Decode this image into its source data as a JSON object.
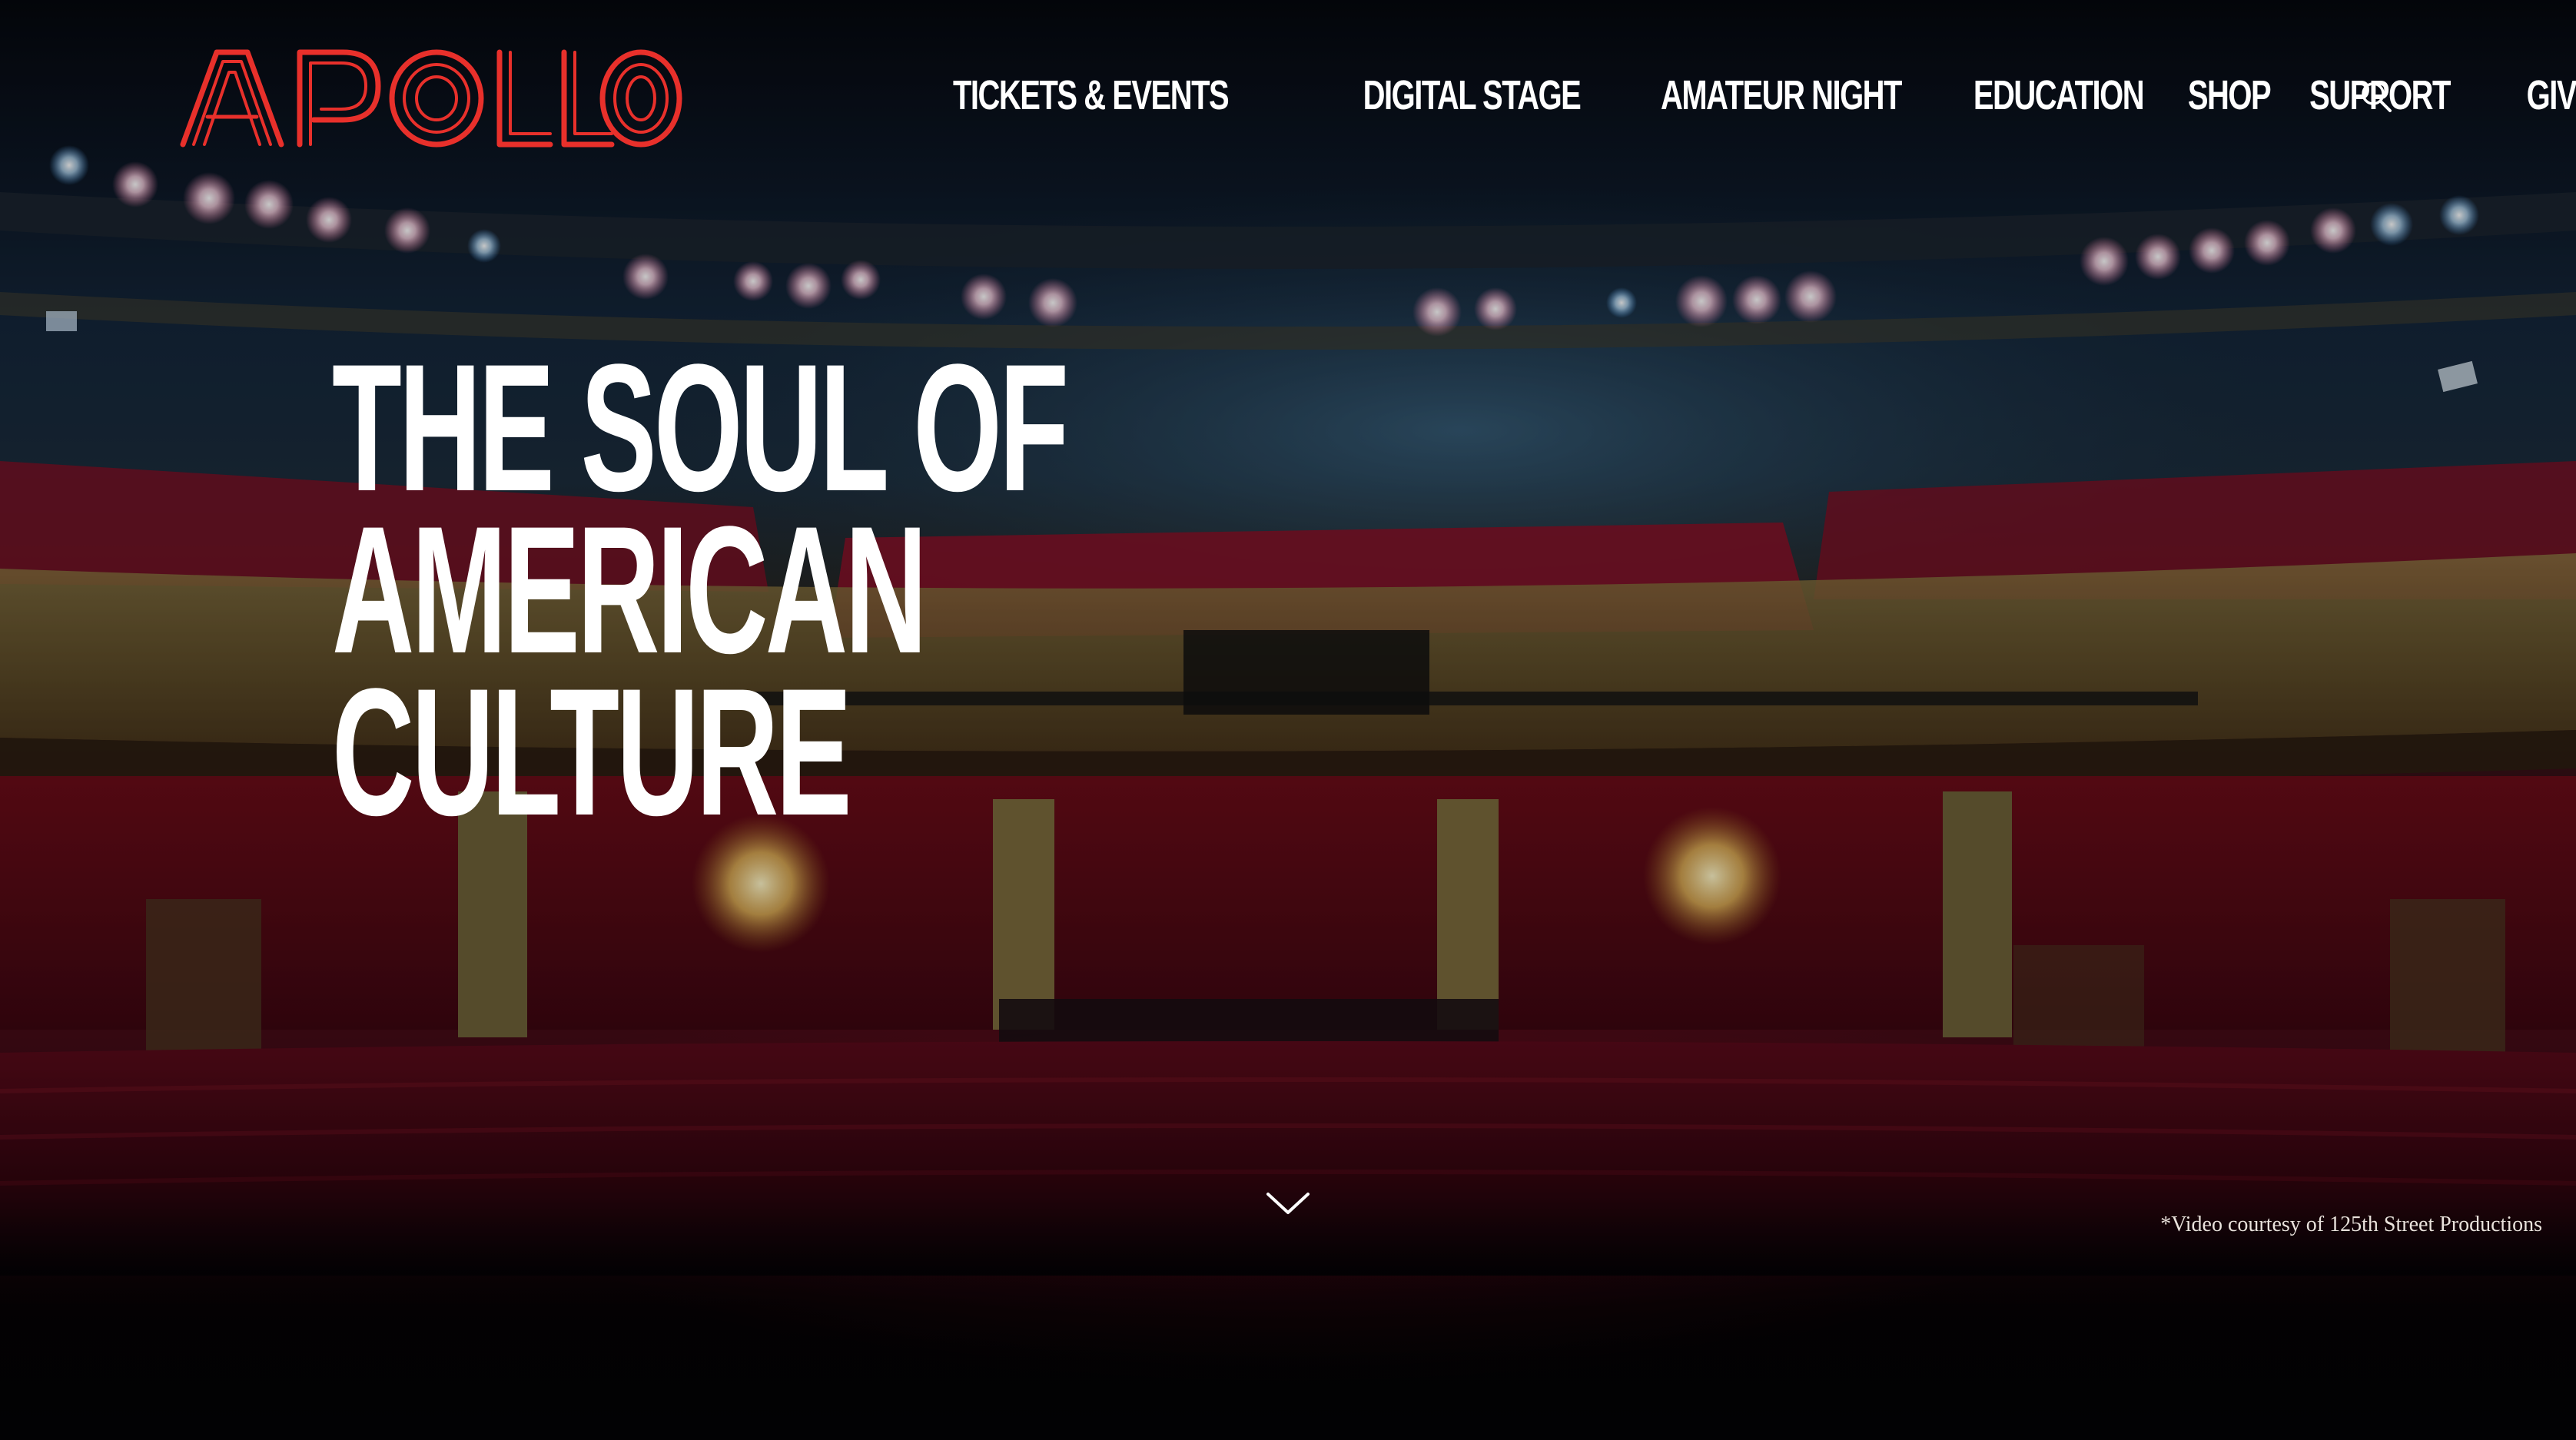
{
  "brand": {
    "name": "APOLLO",
    "color": "#e8302b"
  },
  "nav": {
    "items": [
      {
        "label": "TICKETS & EVENTS"
      },
      {
        "label": "DIGITAL STAGE"
      },
      {
        "label": "AMATEUR NIGHT"
      },
      {
        "label": "EDUCATION"
      },
      {
        "label": "SHOP"
      },
      {
        "label": "SUPPORT"
      },
      {
        "label": "GIVE NOW"
      }
    ],
    "search_icon": "search-icon"
  },
  "hero": {
    "headline_lines": [
      "THE SOUL OF",
      "AMERICAN",
      "CULTURE"
    ],
    "scroll_icon": "chevron-down-icon",
    "credit": "*Video courtesy of 125th Street Productions"
  }
}
